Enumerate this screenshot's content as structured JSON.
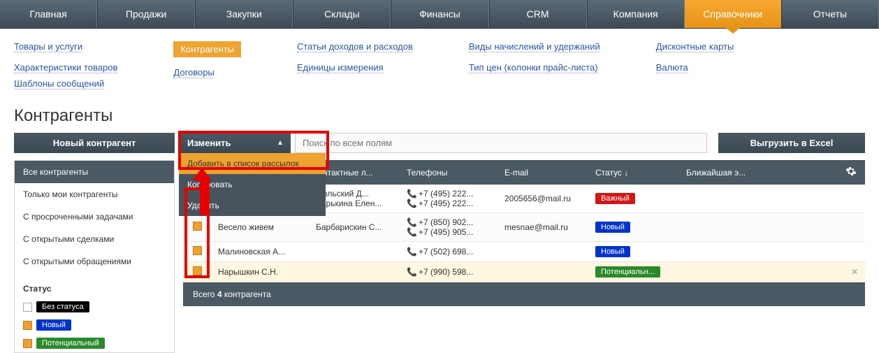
{
  "topnav": {
    "items": [
      "Главная",
      "Продажи",
      "Закупки",
      "Склады",
      "Финансы",
      "CRM",
      "Компания",
      "Справочники",
      "Отчеты"
    ],
    "active_index": 7
  },
  "sublinks": {
    "col0": [
      "Товары и услуги",
      "Характеристики товаров"
    ],
    "col1": [
      "Контрагенты",
      "Договоры"
    ],
    "col2": [
      "Статьи доходов и расходов",
      "Единицы измерения"
    ],
    "col3": [
      "Виды начислений и удержаний",
      "Тип цен (колонки прайс-листа)"
    ],
    "col4": [
      "Дисконтные карты",
      "Валюта"
    ],
    "col5": [
      "Шаблоны сообщений"
    ]
  },
  "page_title": "Контрагенты",
  "toolbar": {
    "new_label": "Новый контрагент",
    "change_label": "Изменить",
    "dropdown": {
      "add_mailing": "Добавить в список рассылок",
      "copy": "Копировать",
      "delete": "Удалить"
    },
    "search_placeholder": "Поиск по всем полям",
    "export_label": "Выгрузить в Excel"
  },
  "sidebar": {
    "filters": [
      "Все контрагенты",
      "Только мои контрагенты",
      "С просроченными задачами",
      "С открытыми сделками",
      "С открытыми обращениями"
    ],
    "status_heading": "Статус",
    "statuses": [
      {
        "label": "Без статуса",
        "cls": "sb-none",
        "selected": false
      },
      {
        "label": "Новый",
        "cls": "sb-new",
        "selected": true
      },
      {
        "label": "Потенциальный",
        "cls": "sb-potential",
        "selected": true
      }
    ]
  },
  "table": {
    "headers": {
      "contact": "...нтактные л...",
      "phone": "Телефоны",
      "email": "E-mail",
      "status": "Статус",
      "next": "Ближайшая э..."
    },
    "rows": [
      {
        "name": "",
        "contact_a": "...ольский Д...",
        "contact_b": "Ларькина Елен...",
        "phones": [
          "+7 (495) 222...",
          "+7 (495) 222..."
        ],
        "email": "2005656@mail.ru",
        "status": "Важный",
        "status_cls": "sb-important"
      },
      {
        "name": "Весело живем",
        "contact_a": "Барбарискин С...",
        "contact_b": "",
        "phones": [
          "+7 (850) 902...",
          "+7 (495) 905..."
        ],
        "email": "mesnae@mail.ru",
        "status": "Новый",
        "status_cls": "sb-new"
      },
      {
        "name": "Малиновская А...",
        "contact_a": "",
        "contact_b": "",
        "phones": [
          "+7 (502) 698..."
        ],
        "email": "",
        "status": "Новый",
        "status_cls": "sb-new"
      },
      {
        "name": "Нарышкин С.Н.",
        "contact_a": "",
        "contact_b": "",
        "phones": [
          "+7 (990) 598..."
        ],
        "email": "",
        "status": "Потенциальн...",
        "status_cls": "sb-potential-trunc"
      }
    ],
    "footer_prefix": "Всего ",
    "footer_count": "4",
    "footer_suffix": " контрагента"
  }
}
